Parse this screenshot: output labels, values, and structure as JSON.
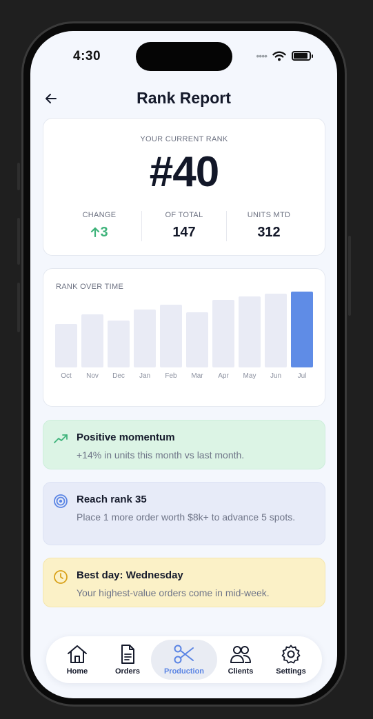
{
  "status_bar": {
    "time": "4:30"
  },
  "header": {
    "title": "Rank Report"
  },
  "rank_card": {
    "label": "YOUR CURRENT RANK",
    "rank": "#40",
    "stats": [
      {
        "label": "CHANGE",
        "value": "3",
        "arrow": "up",
        "color": "#3eb37a"
      },
      {
        "label": "OF TOTAL",
        "value": "147"
      },
      {
        "label": "UNITS MTD",
        "value": "312"
      }
    ]
  },
  "rank_chart": {
    "label": "RANK OVER TIME",
    "colors": {
      "bar": "#e9ebf5",
      "highlight": "#5f8ce6"
    }
  },
  "chart_data": {
    "type": "bar",
    "title": "RANK OVER TIME",
    "categories": [
      "Oct",
      "Nov",
      "Dec",
      "Jan",
      "Feb",
      "Mar",
      "Apr",
      "May",
      "Jun",
      "Jul"
    ],
    "values": [
      63,
      77,
      68,
      84,
      91,
      80,
      98,
      103,
      107,
      110
    ],
    "highlight_index": 9,
    "grid": false,
    "yaxis_visible": false
  },
  "alerts": [
    {
      "icon": "trending-up-icon",
      "title": "Positive momentum",
      "body": "+14% in units this month vs last month.",
      "color": "#3eb37a"
    },
    {
      "icon": "target-icon",
      "title": "Reach rank 35",
      "body": "Place 1 more order worth $8k+ to advance 5 spots.",
      "color": "#5b85e4"
    },
    {
      "icon": "clock-icon",
      "title": "Best day: Wednesday",
      "body": "Your highest-value orders come in mid-week.",
      "color": "#d9a21b"
    }
  ],
  "tabbar": {
    "tabs": [
      {
        "label": "Home",
        "icon": "home-icon"
      },
      {
        "label": "Orders",
        "icon": "document-icon"
      },
      {
        "label": "Production",
        "icon": "scissors-icon",
        "active": true
      },
      {
        "label": "Clients",
        "icon": "users-icon"
      },
      {
        "label": "Settings",
        "icon": "gear-icon"
      }
    ]
  }
}
